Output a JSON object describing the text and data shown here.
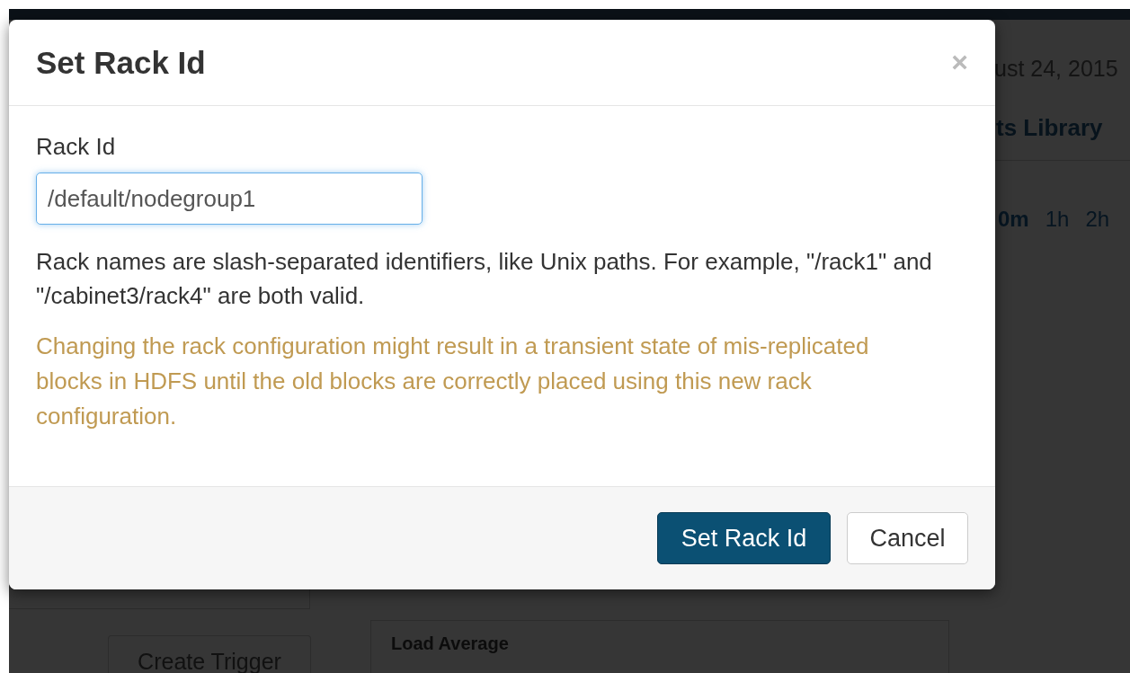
{
  "background_page": {
    "date": "ust 24, 2015",
    "heading": "ts Library",
    "time_ranges": [
      "0m",
      "1h",
      "2h"
    ],
    "create_trigger": "Create Trigger",
    "panel_title": "Load Average"
  },
  "dialog": {
    "title": "Set Rack Id",
    "close": "×",
    "field": {
      "label": "Rack Id",
      "value": "/default/nodegroup1",
      "focused": true
    },
    "help": "Rack names are slash-separated identifiers, like Unix paths. For example, \"/rack1\" and \"/cabinet3/rack4\" are both valid.",
    "warning": "Changing the rack configuration might result in a transient state of mis-replicated blocks in HDFS until the old blocks are correctly placed using this new rack configuration.",
    "buttons": [
      {
        "label": "Set Rack Id",
        "kind": "primary"
      },
      {
        "label": "Cancel",
        "kind": "default"
      }
    ]
  }
}
